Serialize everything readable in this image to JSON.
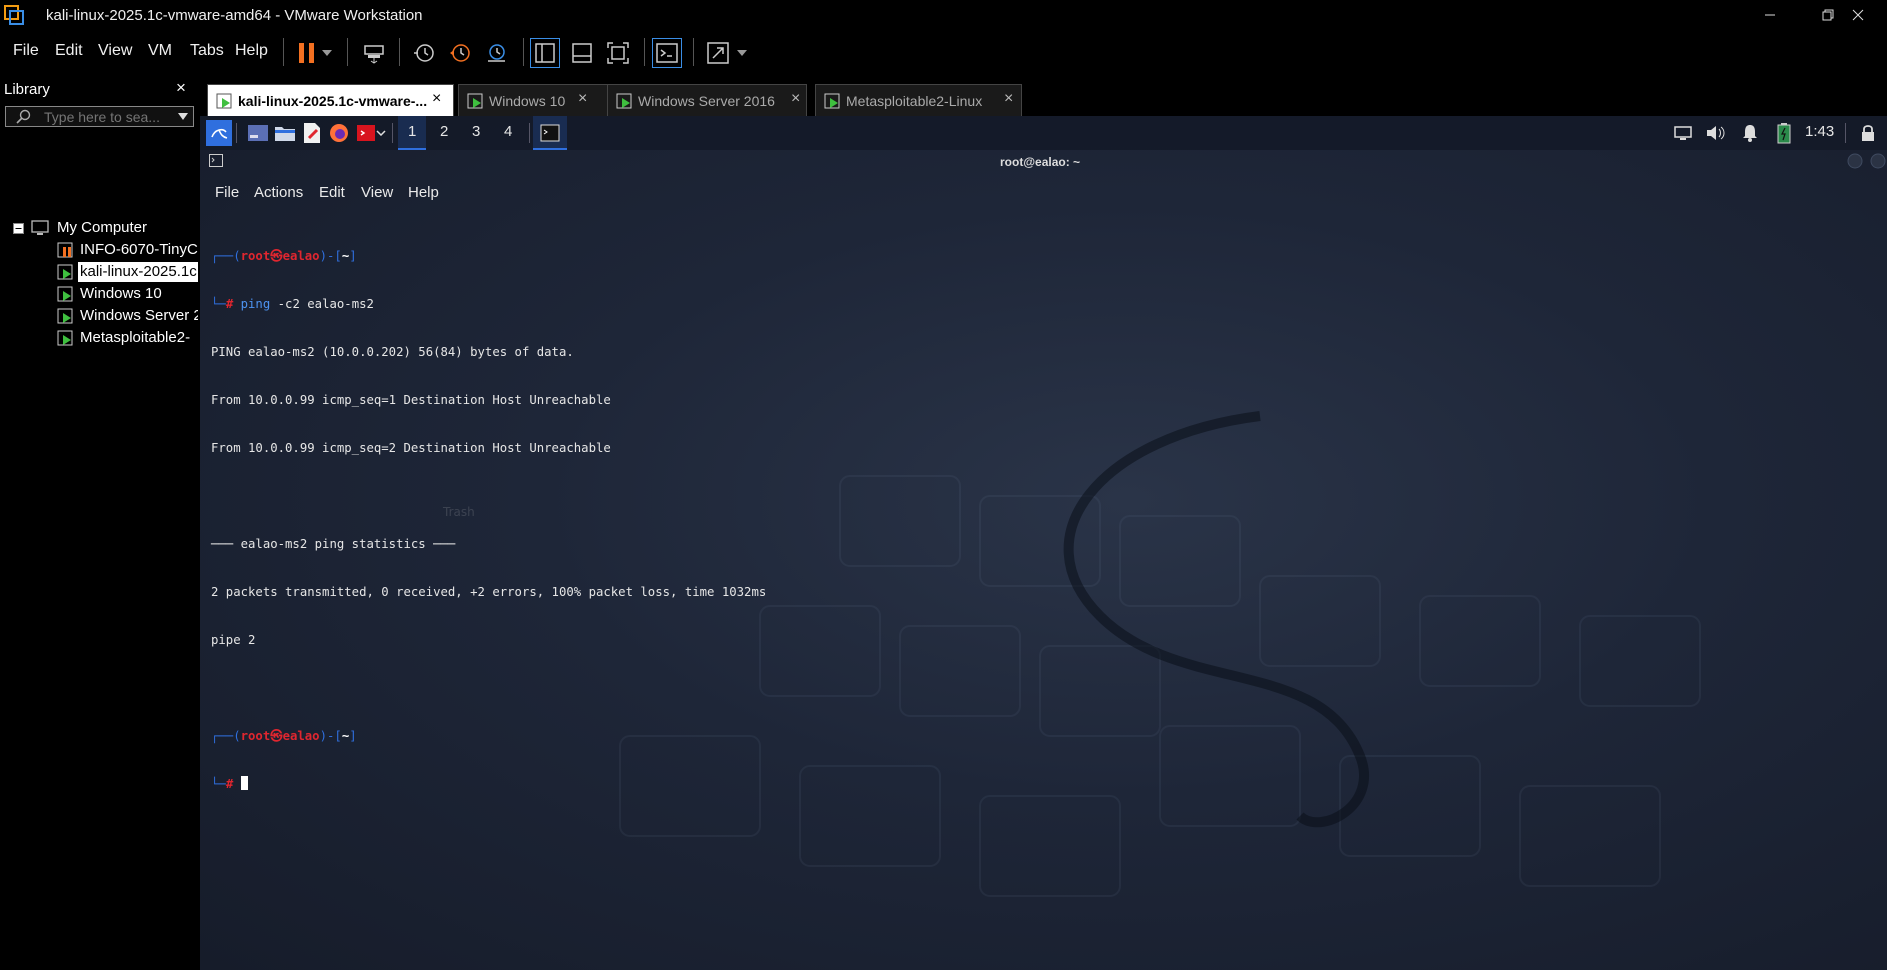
{
  "window": {
    "title": "kali-linux-2025.1c-vmware-amd64 - VMware Workstation",
    "app_icon": "vmware-icon",
    "controls": [
      "minimize-icon",
      "restore-icon",
      "close-icon"
    ]
  },
  "menubar": {
    "items": [
      "File",
      "Edit",
      "View",
      "VM",
      "Tabs",
      "Help"
    ],
    "toolbar_icons": [
      "pause-icon",
      "dropdown-arrow-icon",
      "send-ctrl-alt-del-icon",
      "snapshot-icon",
      "revert-snapshot-icon",
      "snapshot-manager-icon",
      "library-view-icon",
      "thumbnail-view-icon",
      "fullscreen-icon",
      "console-view-icon",
      "stretch-guest-icon",
      "dropdown-arrow-icon"
    ]
  },
  "library": {
    "title": "Library",
    "close": "×",
    "search_placeholder": "Type here to sea...",
    "root": "My Computer",
    "vms": [
      {
        "label": "INFO-6070-TinyC",
        "state": "paused"
      },
      {
        "label": "kali-linux-2025.1c",
        "state": "running",
        "selected": true
      },
      {
        "label": "Windows 10",
        "state": "running"
      },
      {
        "label": "Windows Server 2",
        "state": "running"
      },
      {
        "label": "Metasploitable2-",
        "state": "running"
      }
    ]
  },
  "tabs": [
    {
      "label": "kali-linux-2025.1c-vmware-...",
      "active": true
    },
    {
      "label": "Windows 10",
      "active": false
    },
    {
      "label": "Windows Server 2016",
      "active": false
    },
    {
      "label": "Metasploitable2-Linux",
      "active": false
    }
  ],
  "guest_panel": {
    "workspaces": [
      "1",
      "2",
      "3",
      "4"
    ],
    "clock": "1:43",
    "colors": {
      "panel_accent": "#2f6fde"
    }
  },
  "terminal": {
    "title": "root@ealao: ~",
    "menu": [
      "File",
      "Actions",
      "Edit",
      "View",
      "Help"
    ],
    "prompt": {
      "open": "┌──(",
      "user": "root",
      "at": "㉿",
      "host": "ealao",
      "mid": ")-[",
      "dir": "~",
      "close": "]",
      "second": "└─",
      "hash": "#"
    },
    "command": {
      "prog": "ping",
      "args": "-c2 ealao-ms2"
    },
    "output": [
      "PING ealao-ms2 (10.0.0.202) 56(84) bytes of data.",
      "From 10.0.0.99 icmp_seq=1 Destination Host Unreachable",
      "From 10.0.0.99 icmp_seq=2 Destination Host Unreachable",
      "",
      "─── ealao-ms2 ping statistics ───",
      "2 packets transmitted, 0 received, +2 errors, 100% packet loss, time 1032ms",
      "pipe 2"
    ],
    "ghost_label": "Trash",
    "colors": {
      "user": "#e0262f",
      "bracket": "#2f6fde",
      "prog": "#4d93f0"
    }
  }
}
